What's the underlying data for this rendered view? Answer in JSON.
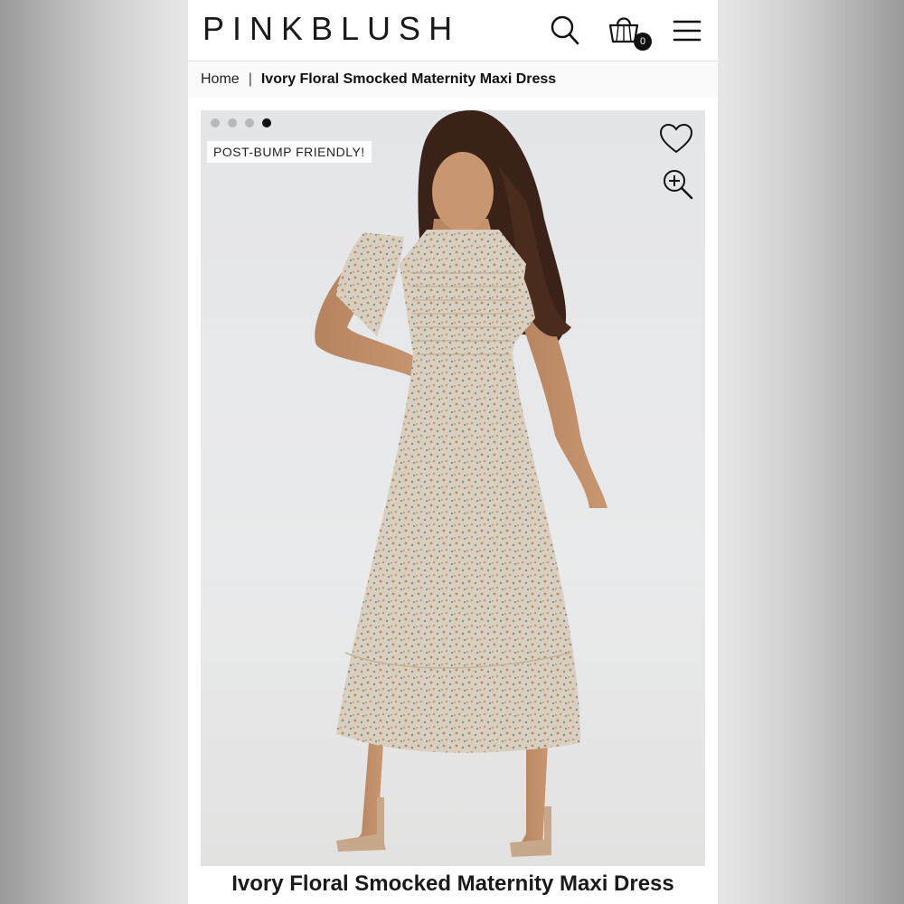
{
  "brand": {
    "logo_text": "PINKBLUSH"
  },
  "header": {
    "icons": [
      "search-icon",
      "shopping-bag-icon",
      "hamburger-menu-icon"
    ],
    "cart_count": "0"
  },
  "breadcrumb": {
    "home": "Home",
    "separator": "|",
    "current": "Ivory Floral Smocked Maternity Maxi Dress"
  },
  "gallery": {
    "slide_count": 4,
    "active_slide": 4,
    "badge": "POST-BUMP FRIENDLY!",
    "icons": [
      "heart-icon",
      "zoom-in-icon"
    ]
  },
  "product": {
    "title": "Ivory Floral Smocked Maternity Maxi Dress"
  },
  "colors": {
    "accent": "#111111",
    "dot_inactive": "#b9b9b9",
    "photo_bg": "#e6e7e8"
  }
}
